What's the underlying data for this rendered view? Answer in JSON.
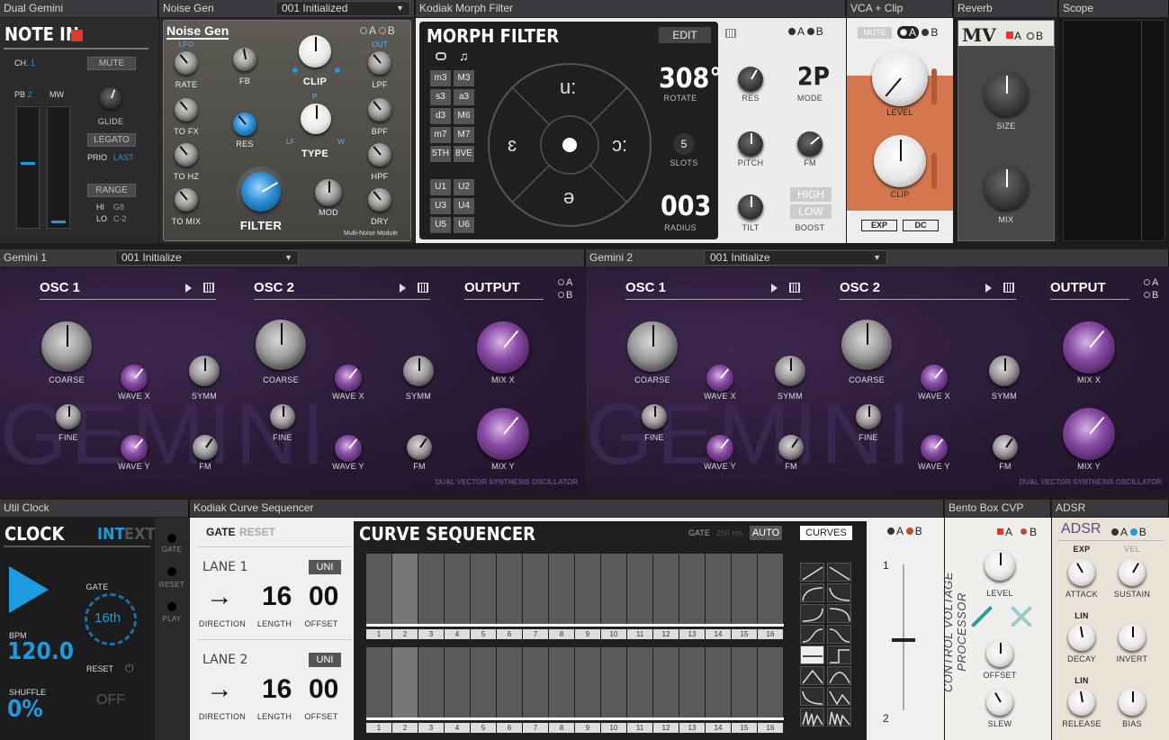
{
  "dual_gemini": {
    "header": "Dual Gemini",
    "title": "NOTE IN",
    "ch_label": "CH.",
    "ch_value": "1",
    "mute": "MUTE",
    "pb_label": "PB",
    "pb_value": "2",
    "mw_label": "MW",
    "glide": "GLIDE",
    "legato": "LEGATO",
    "prio_label": "PRIO",
    "prio_value": "LAST",
    "range": "RANGE",
    "hi_label": "HI",
    "hi_value": "G8",
    "lo_label": "LO",
    "lo_value": "C-2"
  },
  "noise_gen": {
    "header": "Noise Gen",
    "preset": "001  Initialized",
    "title": "Noise Gen",
    "a": "A",
    "b": "B",
    "lfo": "LFO",
    "out": "OUT",
    "rate": "RATE",
    "fb": "FB",
    "clip": "CLIP",
    "lpf": "LPF",
    "to_fx": "TO FX",
    "res": "RES",
    "p": "P",
    "type": "TYPE",
    "bpf": "BPF",
    "to_hz": "TO HZ",
    "lf": "LF",
    "w": "W",
    "hpf": "HPF",
    "to_mix": "TO MIX",
    "filter": "FILTER",
    "mod": "MOD",
    "dry": "DRY",
    "module": "Multi-Noise Module"
  },
  "morph": {
    "header": "Kodiak Morph Filter",
    "title": "MORPH FILTER",
    "edit": "EDIT",
    "a": "A",
    "b": "B",
    "slots_grid": [
      [
        "m3",
        "M3"
      ],
      [
        "s3",
        "a3"
      ],
      [
        "d3",
        "M6"
      ],
      [
        "m7",
        "M7"
      ],
      [
        "5TH",
        "8VE"
      ]
    ],
    "user_grid": [
      [
        "U1",
        "U2"
      ],
      [
        "U3",
        "U4"
      ],
      [
        "U5",
        "U6"
      ]
    ],
    "vowel_top": "u:",
    "vowel_left": "ɛ",
    "vowel_right": "ɔ:",
    "vowel_bottom": "ə",
    "rotate_value": "308°",
    "rotate_label": "ROTATE",
    "slots_value": "5",
    "slots_label": "SLOTS",
    "radius_value": "003",
    "radius_label": "RADIUS",
    "res": "RES",
    "mode_value": "2P",
    "mode_label": "MODE",
    "pitch": "PITCH",
    "fm": "FM",
    "tilt": "TILT",
    "high": "HIGH",
    "low": "LOW",
    "boost": "BOOST"
  },
  "vca": {
    "header": "VCA + Clip",
    "mute": "MUTE",
    "a": "A",
    "b": "B",
    "level": "LEVEL",
    "clip": "CLIP",
    "exp": "EXP",
    "dc": "DC"
  },
  "reverb": {
    "header": "Reverb",
    "logo": "MV",
    "a": "A",
    "b": "B",
    "size": "SIZE",
    "mix": "MIX"
  },
  "scope": {
    "header": "Scope"
  },
  "gemini1": {
    "header": "Gemini 1",
    "preset": "001  Initialize",
    "osc1": "OSC 1",
    "osc2": "OSC 2",
    "output": "OUTPUT",
    "a": "A",
    "b": "B",
    "coarse": "COARSE",
    "wave_x": "WAVE X",
    "symm": "SYMM",
    "fine": "FINE",
    "wave_y": "WAVE Y",
    "fm": "FM",
    "mix_x": "MIX X",
    "mix_y": "MIX Y",
    "logo": "GEMINI",
    "tagline": "DUAL VECTOR SYNTHESIS OSCILLATOR"
  },
  "gemini2": {
    "header": "Gemini 2",
    "preset": "001  Initialize",
    "osc1": "OSC 1",
    "osc2": "OSC 2",
    "output": "OUTPUT",
    "a": "A",
    "b": "B",
    "coarse": "COARSE",
    "wave_x": "WAVE X",
    "symm": "SYMM",
    "fine": "FINE",
    "wave_y": "WAVE Y",
    "fm": "FM",
    "mix_x": "MIX X",
    "mix_y": "MIX Y",
    "logo": "GEMINI",
    "tagline": "DUAL VECTOR SYNTHESIS OSCILLATOR"
  },
  "clock": {
    "header": "Util Clock",
    "title": "CLOCK",
    "int": "INT",
    "ext": "EXT",
    "gate_out": "GATE",
    "reset_out": "RESET",
    "play_out": "PLAY",
    "gate_label": "GATE",
    "gate_value": "16th",
    "bpm_label": "BPM",
    "bpm_value": "120.0",
    "reset": "RESET",
    "shuffle_label": "SHUFFLE",
    "shuffle_value": "0%",
    "off": "OFF"
  },
  "seq": {
    "header": "Kodiak Curve Sequencer",
    "gate_tab": "GATE",
    "reset_tab": "RESET",
    "title": "CURVE SEQUENCER",
    "gate_label": "GATE",
    "gate_ms": "250 ms",
    "auto": "AUTO",
    "curves": "CURVES",
    "a": "A",
    "b": "B",
    "lanes": [
      {
        "name": "LANE 1",
        "uni": "UNI",
        "arrow": "→",
        "length": "16",
        "offset": "00",
        "direction_label": "DIRECTION",
        "length_label": "LENGTH",
        "offset_label": "OFFSET"
      },
      {
        "name": "LANE 2",
        "uni": "UNI",
        "arrow": "→",
        "length": "16",
        "offset": "00",
        "direction_label": "DIRECTION",
        "length_label": "LENGTH",
        "offset_label": "OFFSET"
      }
    ],
    "steps": [
      "1",
      "2",
      "3",
      "4",
      "5",
      "6",
      "7",
      "8",
      "9",
      "10",
      "11",
      "12",
      "13",
      "14",
      "15",
      "16"
    ],
    "fader_top": "1",
    "fader_bottom": "2"
  },
  "bento": {
    "header": "Bento Box CVP",
    "vertical": "CONTROL VOLTAGE PROCESSOR",
    "a": "A",
    "b": "B",
    "level": "LEVEL",
    "offset": "OFFSET",
    "slew": "SLEW"
  },
  "adsr": {
    "header": "ADSR",
    "title": "ADSR",
    "a": "A",
    "b": "B",
    "exp": "EXP",
    "vel": "VEL",
    "attack": "ATTACK",
    "sustain": "SUSTAIN",
    "lin1": "LIN",
    "decay": "DECAY",
    "invert": "INVERT",
    "lin2": "LIN",
    "release": "RELEASE",
    "bias": "BIAS"
  },
  "colors": {
    "accent_blue": "#1e9be0",
    "purple": "#7a3f96",
    "vca_orange": "#d4774e",
    "red": "#e0392b"
  }
}
